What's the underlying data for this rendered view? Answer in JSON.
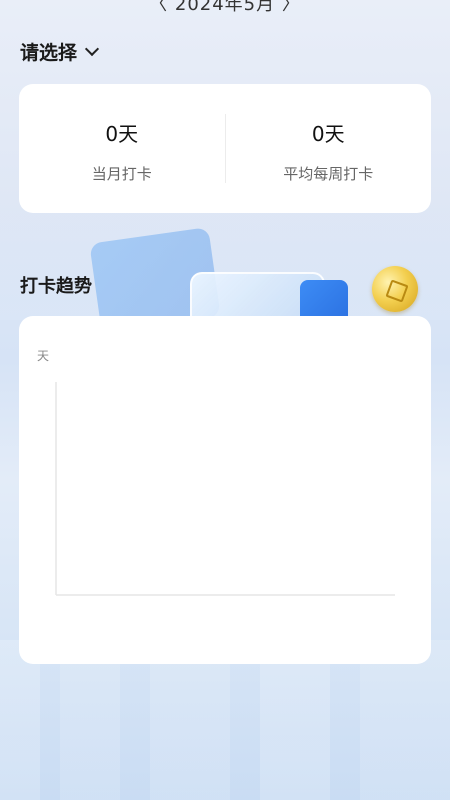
{
  "header": {
    "month_partial": "〈 2024年5月 〉"
  },
  "selector": {
    "label": "请选择"
  },
  "stats": {
    "month_value": "0天",
    "month_label": "当月打卡",
    "week_avg_value": "0天",
    "week_avg_label": "平均每周打卡"
  },
  "trend": {
    "title": "打卡趋势"
  },
  "chart_data": {
    "type": "line",
    "title": "",
    "ylabel": "天",
    "xlabel": "",
    "series": [],
    "grid": false
  }
}
